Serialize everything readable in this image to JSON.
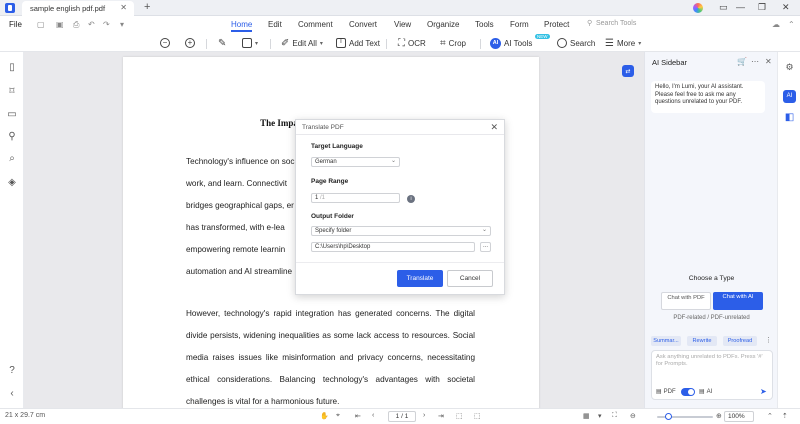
{
  "titlebar": {
    "tab_title": "sample english pdf.pdf",
    "close": "✕",
    "new_tab": "+",
    "window_controls": [
      "—",
      "❐",
      "✕"
    ]
  },
  "menu": {
    "file": "File",
    "tabs": [
      "Home",
      "Edit",
      "Comment",
      "Convert",
      "View",
      "Organize",
      "Tools",
      "Form",
      "Protect"
    ],
    "active_tab": "Home",
    "search_tools": "Search Tools"
  },
  "toolbar": {
    "edit_all": "Edit All",
    "add_text": "Add Text",
    "ocr": "OCR",
    "crop": "Crop",
    "ai_tools": "AI Tools",
    "new_badge": "NEW",
    "search": "Search",
    "more": "More"
  },
  "document": {
    "title": "The Impact of Technology on Society",
    "para1": [
      "Technology's influence on soc",
      "work, and learn. Connectivit",
      "bridges geographical gaps, er",
      "has transformed, with e-lea",
      "empowering remote learnin",
      "automation and AI streamline"
    ],
    "para2": [
      "However, technology's rapid integration has generated concerns. The digital",
      "divide persists, widening inequalities as some lack access to resources. Social",
      "media raises issues like misinformation and privacy concerns, necessitating",
      "ethical considerations. Balancing technology's advantages with societal",
      "challenges is vital for a harmonious future."
    ]
  },
  "dialog": {
    "title": "Translate PDF",
    "target_language_label": "Target Language",
    "target_language_value": "German",
    "page_range_label": "Page Range",
    "page_range_value": "1",
    "page_range_total": "/1",
    "output_folder_label": "Output Folder",
    "output_folder_option": "Specify folder",
    "output_path": "C:\\Users\\hp\\Desktop",
    "browse": "...",
    "translate_button": "Translate",
    "cancel_button": "Cancel"
  },
  "ai_sidebar": {
    "title": "AI Sidebar",
    "greeting": "Hello, I'm Lumi, your AI assistant. Please feel free to ask me any questions unrelated to your PDF.",
    "choose_type": "Choose a Type",
    "chat_pdf": "Chat with PDF",
    "chat_ai": "Chat with AI",
    "caption": "PDF-related / PDF-unrelated",
    "chips": [
      "Summar...",
      "Rewrite",
      "Proofread"
    ],
    "input_placeholder": "Ask anything unrelated to PDFs. Press '#' for Prompts.",
    "opt_pdf": "PDF",
    "opt_ai": "AI"
  },
  "statusbar": {
    "page_size": "21 x 29.7 cm",
    "page_indicator": "1 / 1",
    "zoom": "100%",
    "zoom_level": 0.25
  },
  "colors": {
    "accent": "#2c5ee8",
    "badge": "#33c1e4"
  }
}
